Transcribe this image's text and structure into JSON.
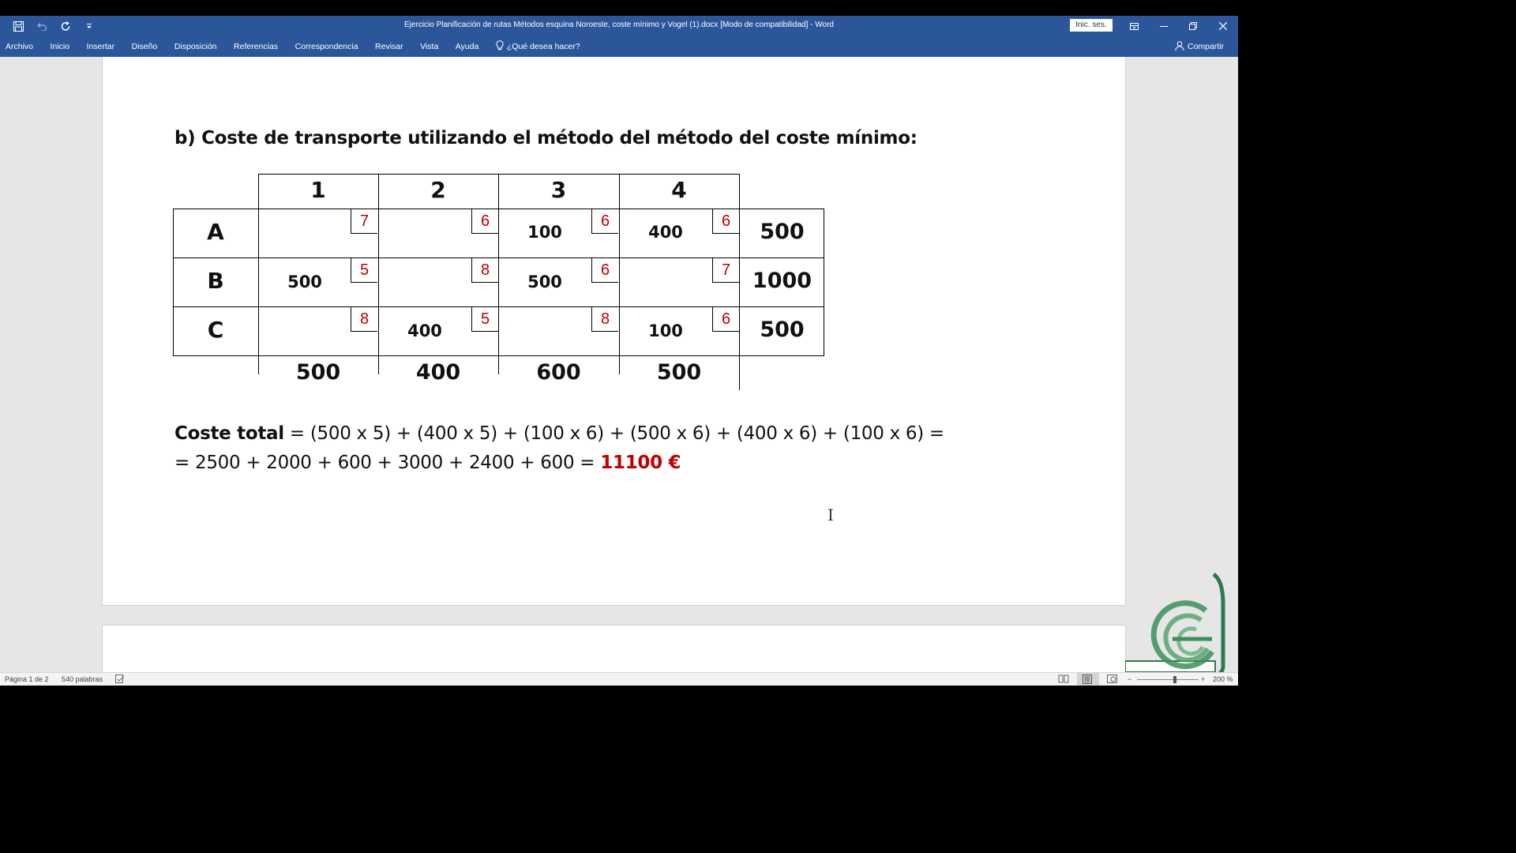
{
  "window": {
    "title": "Ejercicio Planificación de rutas Métodos esquina Noroeste, coste mínimo y Vogel (1).docx [Modo de compatibilidad]  -  Word",
    "signin_label": "Inic. ses."
  },
  "ribbon": {
    "tabs": [
      "Archivo",
      "Inicio",
      "Insertar",
      "Diseño",
      "Disposición",
      "Referencias",
      "Correspondencia",
      "Revisar",
      "Vista",
      "Ayuda"
    ],
    "tell_me": "¿Qué desea hacer?",
    "share": "Compartir"
  },
  "document": {
    "heading": "b) Coste de transporte utilizando el método del método del coste mínimo:",
    "table": {
      "columns": [
        "1",
        "2",
        "3",
        "4"
      ],
      "rows": [
        {
          "label": "A",
          "costs": [
            "7",
            "6",
            "6",
            "6"
          ],
          "allocations": [
            "",
            "",
            "100",
            "400"
          ],
          "supply": "500"
        },
        {
          "label": "B",
          "costs": [
            "5",
            "8",
            "6",
            "7"
          ],
          "allocations": [
            "500",
            "",
            "500",
            ""
          ],
          "supply": "1000"
        },
        {
          "label": "C",
          "costs": [
            "8",
            "5",
            "8",
            "6"
          ],
          "allocations": [
            "",
            "400",
            "",
            "100"
          ],
          "supply": "500"
        }
      ],
      "demand": [
        "500",
        "400",
        "600",
        "500"
      ]
    },
    "formula": {
      "label": "Coste total",
      "line1_rest": " = (500 x 5) + (400 x 5) + (100 x 6) + (500 x 6) + (400 x 6) + (100 x 6) =",
      "line2_prefix": "= 2500 + 2000 + 600 + 3000 + 2400 + 600 = ",
      "total": "11100 €"
    }
  },
  "statusbar": {
    "page": "Página 1 de 2",
    "words": "540 palabras",
    "zoom": "200 %"
  },
  "colors": {
    "title_bar": "#2b579a",
    "cost_red": "#c00000"
  }
}
